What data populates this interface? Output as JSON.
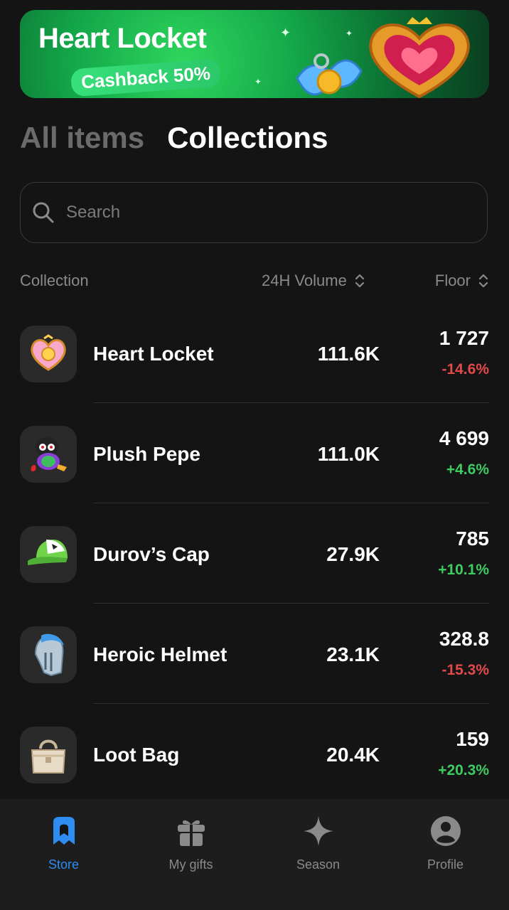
{
  "banner": {
    "title": "Heart Locket",
    "promo": "Cashback 50%"
  },
  "tabs": [
    {
      "label": "All items",
      "active": false
    },
    {
      "label": "Collections",
      "active": true
    }
  ],
  "search": {
    "placeholder": "Search"
  },
  "table_header": {
    "collection": "Collection",
    "volume": "24H Volume",
    "floor": "Floor"
  },
  "rows": [
    {
      "name": "Heart Locket",
      "volume": "111.6K",
      "floor": "1 727",
      "change": "-14.6%",
      "trend": "down",
      "icon": "heart-locket-icon"
    },
    {
      "name": "Plush Pepe",
      "volume": "111.0K",
      "floor": "4 699",
      "change": "+4.6%",
      "trend": "up",
      "icon": "plush-pepe-icon"
    },
    {
      "name": "Durov’s Cap",
      "volume": "27.9K",
      "floor": "785",
      "change": "+10.1%",
      "trend": "up",
      "icon": "cap-icon"
    },
    {
      "name": "Heroic Helmet",
      "volume": "23.1K",
      "floor": "328.8",
      "change": "-15.3%",
      "trend": "down",
      "icon": "helmet-icon"
    },
    {
      "name": "Loot Bag",
      "volume": "20.4K",
      "floor": "159",
      "change": "+20.3%",
      "trend": "up",
      "icon": "loot-bag-icon"
    }
  ],
  "nav": [
    {
      "label": "Store",
      "active": true,
      "icon": "store-icon"
    },
    {
      "label": "My gifts",
      "active": false,
      "icon": "gift-icon"
    },
    {
      "label": "Season",
      "active": false,
      "icon": "sparkle-icon"
    },
    {
      "label": "Profile",
      "active": false,
      "icon": "profile-icon"
    }
  ],
  "colors": {
    "accent": "#2f8cf0",
    "positive": "#3ecb62",
    "negative": "#e24a4a",
    "background": "#141414"
  }
}
